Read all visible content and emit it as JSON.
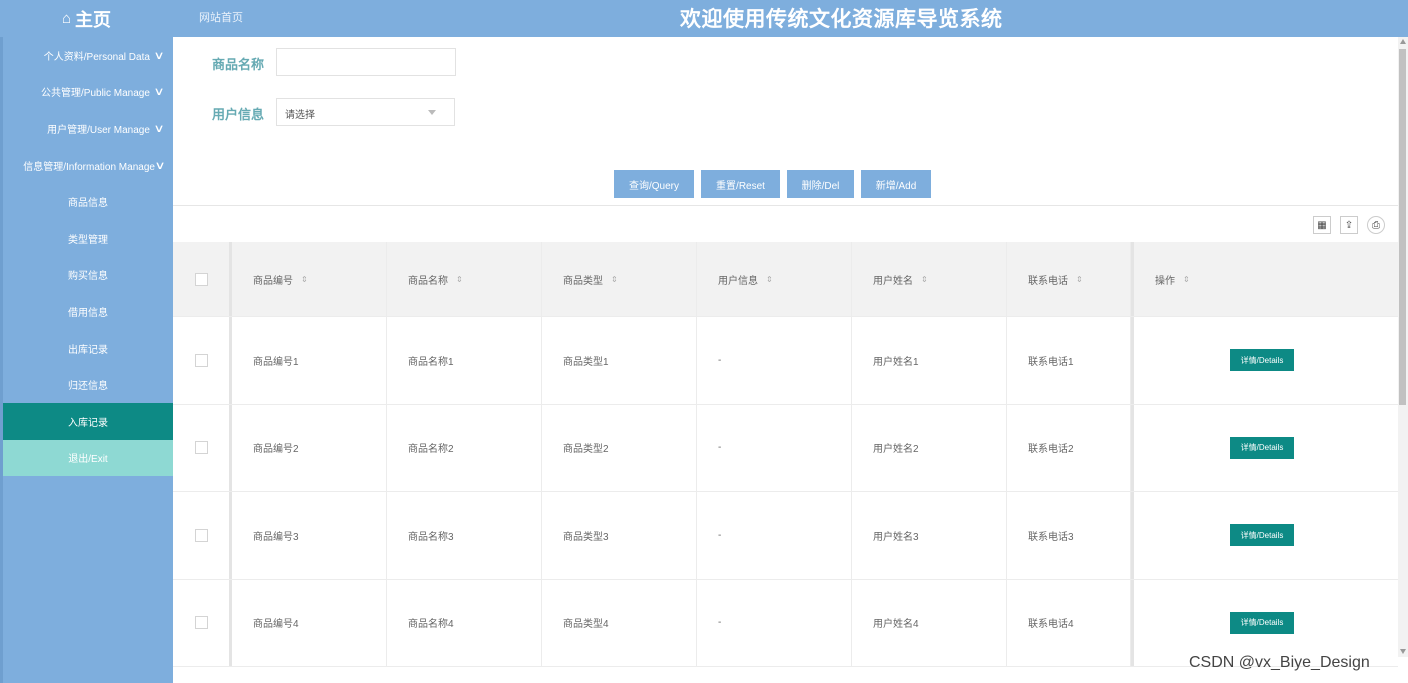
{
  "header": {
    "home_icon": "home-icon",
    "home_label": "主页",
    "site_home_link": "网站首页",
    "system_title": "欢迎使用传统文化资源库导览系统",
    "bar_color": "#7eaedd"
  },
  "sidebar": {
    "groups": [
      {
        "label": "个人资料/Personal Data"
      },
      {
        "label": "公共管理/Public Manage"
      },
      {
        "label": "用户管理/User Manage"
      },
      {
        "label": "信息管理/Information Manage"
      }
    ],
    "items": [
      {
        "label": "商品信息"
      },
      {
        "label": "类型管理"
      },
      {
        "label": "购买信息"
      },
      {
        "label": "借用信息"
      },
      {
        "label": "出库记录"
      },
      {
        "label": "归还信息"
      },
      {
        "label": "入库记录",
        "active": true
      },
      {
        "label": "退出/Exit"
      }
    ],
    "active_color": "#0d8a85",
    "exit_color": "#8ed9d3"
  },
  "search": {
    "name_label": "商品名称",
    "name_value": "",
    "user_label": "用户信息",
    "user_select_value": "请选择"
  },
  "buttons": {
    "query": "查询/Query",
    "reset": "重置/Reset",
    "delete": "删除/Del",
    "add": "新增/Add"
  },
  "table": {
    "columns": [
      "商品编号",
      "商品名称",
      "商品类型",
      "用户信息",
      "用户姓名",
      "联系电话",
      "操作"
    ],
    "rows": [
      {
        "code": "商品编号1",
        "name": "商品名称1",
        "type": "商品类型1",
        "user_info": "-",
        "user_name": "用户姓名1",
        "phone": "联系电话1",
        "action": "详情/Details"
      },
      {
        "code": "商品编号2",
        "name": "商品名称2",
        "type": "商品类型2",
        "user_info": "-",
        "user_name": "用户姓名2",
        "phone": "联系电话2",
        "action": "详情/Details"
      },
      {
        "code": "商品编号3",
        "name": "商品名称3",
        "type": "商品类型3",
        "user_info": "-",
        "user_name": "用户姓名3",
        "phone": "联系电话3",
        "action": "详情/Details"
      },
      {
        "code": "商品编号4",
        "name": "商品名称4",
        "type": "商品类型4",
        "user_info": "-",
        "user_name": "用户姓名4",
        "phone": "联系电话4",
        "action": "详情/Details"
      }
    ]
  },
  "toolbar_icons": [
    "columns-icon",
    "export-icon",
    "print-icon"
  ],
  "watermark": "CSDN @vx_Biye_Design"
}
